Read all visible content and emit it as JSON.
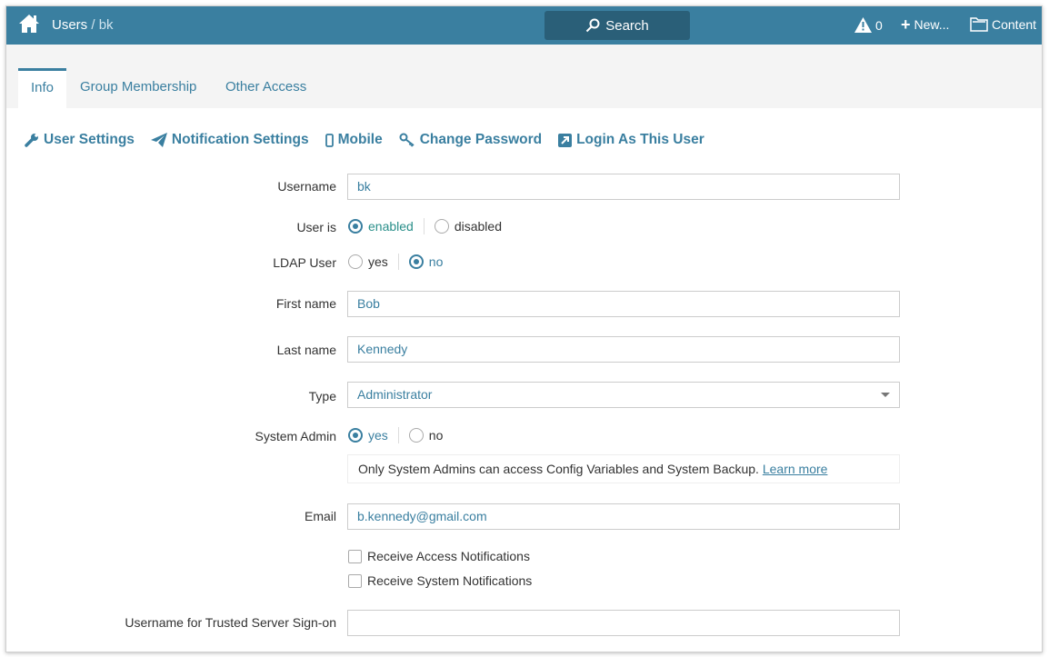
{
  "header": {
    "breadcrumb_root": "Users",
    "breadcrumb_sep": " / ",
    "breadcrumb_current": "bk",
    "search_label": "Search",
    "alerts_count": "0",
    "new_label": "New...",
    "content_label": "Content"
  },
  "tabs": [
    {
      "label": "Info",
      "active": true
    },
    {
      "label": "Group Membership"
    },
    {
      "label": "Other Access"
    }
  ],
  "actions": {
    "user_settings": "User Settings",
    "notification_settings": "Notification Settings",
    "mobile": "Mobile",
    "change_password": "Change Password",
    "login_as": "Login As This User"
  },
  "form": {
    "username_label": "Username",
    "username": "bk",
    "user_is_label": "User is",
    "enabled": "enabled",
    "disabled": "disabled",
    "ldap_label": "LDAP User",
    "ldap_yes": "yes",
    "ldap_no": "no",
    "first_name_label": "First name",
    "first_name": "Bob",
    "last_name_label": "Last name",
    "last_name": "Kennedy",
    "type_label": "Type",
    "type": "Administrator",
    "sysadmin_label": "System Admin",
    "sysadmin_yes": "yes",
    "sysadmin_no": "no",
    "sysadmin_note": "Only System Admins can access Config Variables and System Backup.",
    "learn_more": "Learn more",
    "email_label": "Email",
    "email": "b.kennedy@gmail.com",
    "access_notifications": "Receive Access Notifications",
    "system_notifications": "Receive System Notifications",
    "trusted_label": "Username for Trusted Server Sign-on",
    "trusted": ""
  },
  "colors": {
    "accent": "#3a7fa0",
    "search_bg": "#2a5f78"
  }
}
